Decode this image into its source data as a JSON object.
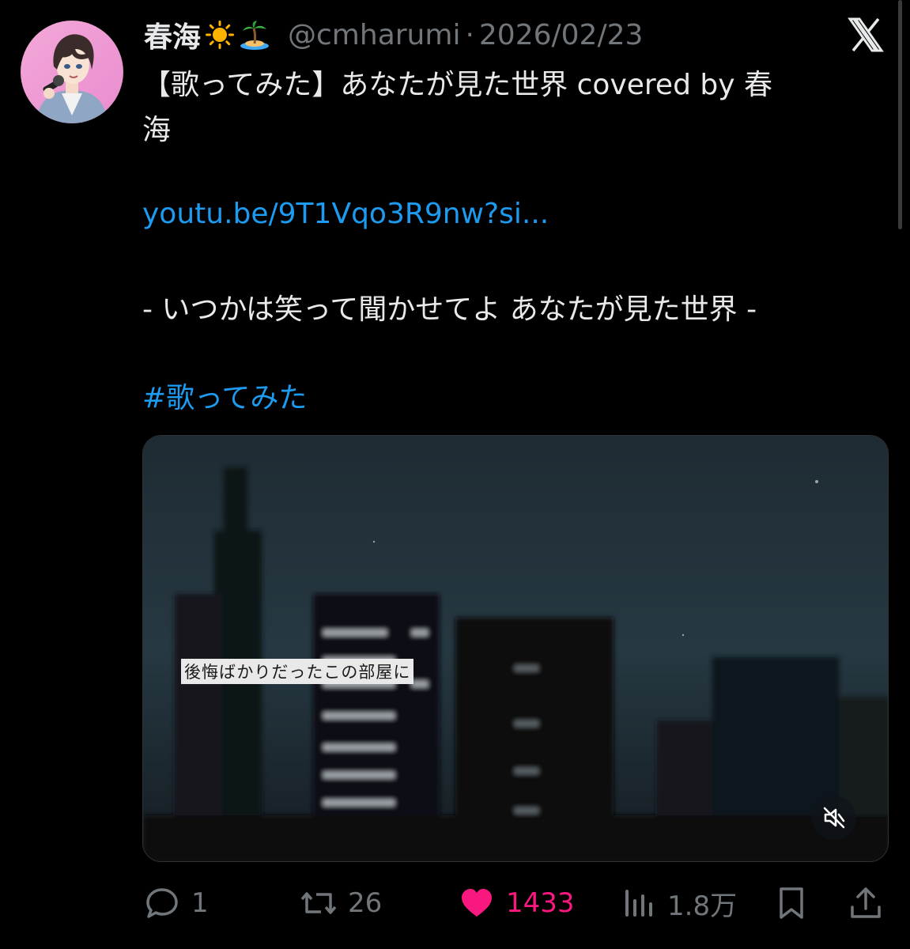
{
  "tweet": {
    "display_name": "春海",
    "emojis": [
      "sun-emoji",
      "island-emoji"
    ],
    "handle": "@cmharumi",
    "separator": "·",
    "date": "2026/02/23",
    "text_line1": "【歌ってみた】あなたが見た世界 covered by 春",
    "text_line2": "海",
    "link": "youtu.be/9T1Vqo3R9nw?si...",
    "lyric_line": "- いつかは笑って聞かせてよ あなたが見た世界 -",
    "hashtag": "#歌ってみた"
  },
  "media": {
    "subtitle": "後悔ばかりだったこの部屋に",
    "muted": true
  },
  "actions": {
    "replies": "1",
    "retweets": "26",
    "likes": "1433",
    "views": "1.8万",
    "liked": true
  },
  "colors": {
    "background": "#000000",
    "text": "#e7e9ea",
    "secondary": "#71767b",
    "link": "#1d9bf0",
    "like": "#f91880"
  }
}
